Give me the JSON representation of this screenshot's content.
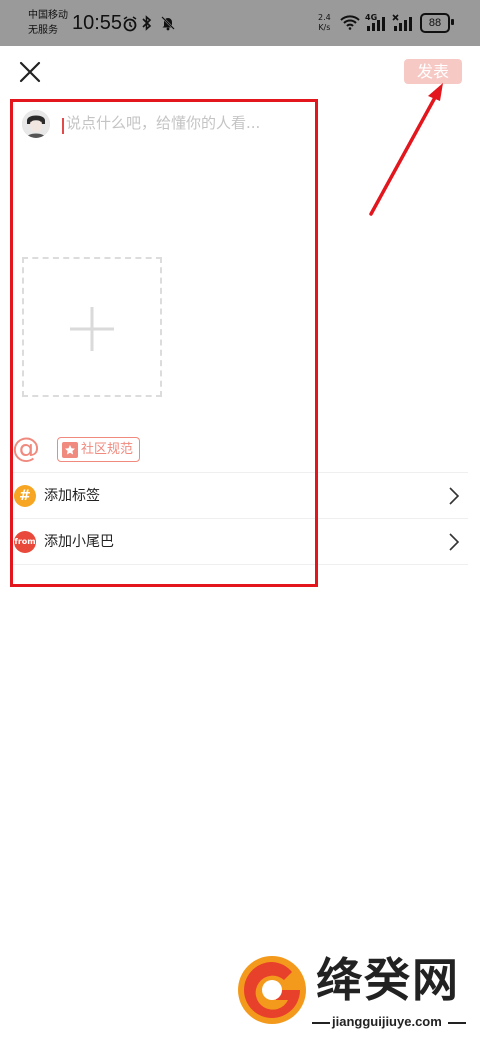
{
  "status_bar": {
    "carrier_line1": "中国移动",
    "carrier_line2": "无服务",
    "time": "10:55",
    "speed_value": "2.4",
    "speed_unit": "K/s",
    "network": "4G",
    "battery": "88",
    "icons": [
      "alarm-icon",
      "bluetooth-icon",
      "mute-icon",
      "wifi-icon",
      "signal-icon",
      "no-signal-icon",
      "battery-icon"
    ]
  },
  "header": {
    "close_icon": "close-icon",
    "publish_label": "发表",
    "publish_color": "#f7c9c5"
  },
  "composer": {
    "placeholder": "说点什么吧，给懂你的人看...",
    "add_image_icon": "plus-icon"
  },
  "toolbar": {
    "mention_symbol": "@",
    "community_label": "社区规范",
    "accent_color": "#f08a7e"
  },
  "options": [
    {
      "icon_text": "#",
      "label": "添加标签",
      "icon_color": "#f6a623"
    },
    {
      "icon_text": "from",
      "label": "添加小尾巴",
      "icon_color": "#e8493b"
    }
  ],
  "annotation": {
    "highlight_color": "#e2161c"
  },
  "watermark": {
    "title": "绛癸网",
    "url": "jiangguijiuye.com"
  }
}
